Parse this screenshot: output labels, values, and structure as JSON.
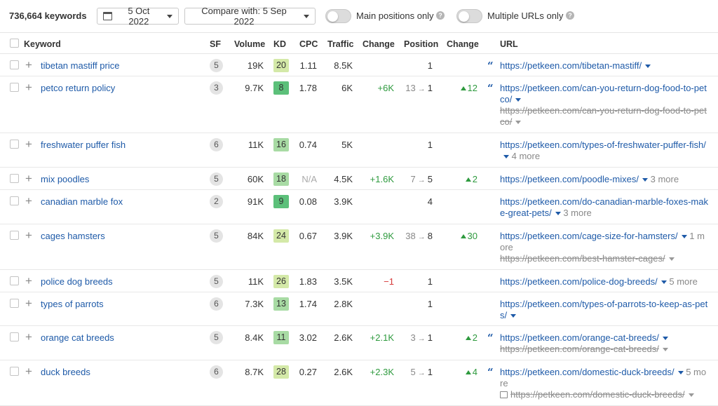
{
  "toolbar": {
    "keyword_count": "736,664 keywords",
    "date": "5 Oct 2022",
    "compare": "Compare with: 5 Sep 2022",
    "main_positions_label": "Main positions only",
    "multiple_urls_label": "Multiple URLs only"
  },
  "headers": {
    "keyword": "Keyword",
    "sf": "SF",
    "volume": "Volume",
    "kd": "KD",
    "cpc": "CPC",
    "traffic": "Traffic",
    "change": "Change",
    "position": "Position",
    "pos_change": "Change",
    "url": "URL"
  },
  "kd_colors": {
    "light": "#d4e9a8",
    "mid": "#a8dba4",
    "green": "#5cc07a"
  },
  "rows": [
    {
      "keyword": "tibetan mastiff price",
      "sf": "5",
      "volume": "19K",
      "kd": "20",
      "kd_color": "#d4e9a8",
      "cpc": "1.11",
      "traffic": "8.5K",
      "change": "",
      "prev_pos": "",
      "pos": "1",
      "pos_change": "",
      "quote": true,
      "url": "https://petkeen.com/tibetan-mastiff/",
      "more": "",
      "old_url": ""
    },
    {
      "keyword": "petco return policy",
      "sf": "3",
      "volume": "9.7K",
      "kd": "8",
      "kd_color": "#5cc07a",
      "cpc": "1.78",
      "traffic": "6K",
      "change": "+6K",
      "prev_pos": "13",
      "pos": "1",
      "pos_change": "12",
      "quote": true,
      "url": "https://petkeen.com/can-you-return-dog-food-to-petco/",
      "more": "",
      "old_url": "https://petkeen.com/can-you-return-dog-food-to-petco/"
    },
    {
      "keyword": "freshwater puffer fish",
      "sf": "6",
      "volume": "11K",
      "kd": "16",
      "kd_color": "#a8dba4",
      "cpc": "0.74",
      "traffic": "5K",
      "change": "",
      "prev_pos": "",
      "pos": "1",
      "pos_change": "",
      "quote": false,
      "url": "https://petkeen.com/types-of-freshwater-puffer-fish/",
      "more": "4 more",
      "old_url": ""
    },
    {
      "keyword": "mix poodles",
      "sf": "5",
      "volume": "60K",
      "kd": "18",
      "kd_color": "#a8dba4",
      "cpc": "N/A",
      "traffic": "4.5K",
      "change": "+1.6K",
      "prev_pos": "7",
      "pos": "5",
      "pos_change": "2",
      "quote": false,
      "url": "https://petkeen.com/poodle-mixes/",
      "more": "3 more",
      "old_url": ""
    },
    {
      "keyword": "canadian marble fox",
      "sf": "2",
      "volume": "91K",
      "kd": "9",
      "kd_color": "#5cc07a",
      "cpc": "0.08",
      "traffic": "3.9K",
      "change": "",
      "prev_pos": "",
      "pos": "4",
      "pos_change": "",
      "quote": false,
      "url": "https://petkeen.com/do-canadian-marble-foxes-make-great-pets/",
      "more": "3 more",
      "old_url": ""
    },
    {
      "keyword": "cages hamsters",
      "sf": "5",
      "volume": "84K",
      "kd": "24",
      "kd_color": "#d4e9a8",
      "cpc": "0.67",
      "traffic": "3.9K",
      "change": "+3.9K",
      "prev_pos": "38",
      "pos": "8",
      "pos_change": "30",
      "quote": false,
      "url": "https://petkeen.com/cage-size-for-hamsters/",
      "more": "1 more",
      "old_url": "https://petkeen.com/best-hamster-cages/"
    },
    {
      "keyword": "police dog breeds",
      "sf": "5",
      "volume": "11K",
      "kd": "26",
      "kd_color": "#d4e9a8",
      "cpc": "1.83",
      "traffic": "3.5K",
      "change": "−1",
      "prev_pos": "",
      "pos": "1",
      "pos_change": "",
      "quote": false,
      "url": "https://petkeen.com/police-dog-breeds/",
      "more": "5 more",
      "old_url": ""
    },
    {
      "keyword": "types of parrots",
      "sf": "6",
      "volume": "7.3K",
      "kd": "13",
      "kd_color": "#a8dba4",
      "cpc": "1.74",
      "traffic": "2.8K",
      "change": "",
      "prev_pos": "",
      "pos": "1",
      "pos_change": "",
      "quote": false,
      "url": "https://petkeen.com/types-of-parrots-to-keep-as-pets/",
      "more": "",
      "old_url": ""
    },
    {
      "keyword": "orange cat breeds",
      "sf": "5",
      "volume": "8.4K",
      "kd": "11",
      "kd_color": "#a8dba4",
      "cpc": "3.02",
      "traffic": "2.6K",
      "change": "+2.1K",
      "prev_pos": "3",
      "pos": "1",
      "pos_change": "2",
      "quote": true,
      "url": "https://petkeen.com/orange-cat-breeds/",
      "more": "",
      "old_url": "https://petkeen.com/orange-cat-breeds/"
    },
    {
      "keyword": "duck breeds",
      "sf": "6",
      "volume": "8.7K",
      "kd": "28",
      "kd_color": "#d4e9a8",
      "cpc": "0.27",
      "traffic": "2.6K",
      "change": "+2.3K",
      "prev_pos": "5",
      "pos": "1",
      "pos_change": "4",
      "quote": true,
      "url": "https://petkeen.com/domestic-duck-breeds/",
      "more": "5 more",
      "old_url": "https://petkeen.com/domestic-duck-breeds/"
    }
  ]
}
